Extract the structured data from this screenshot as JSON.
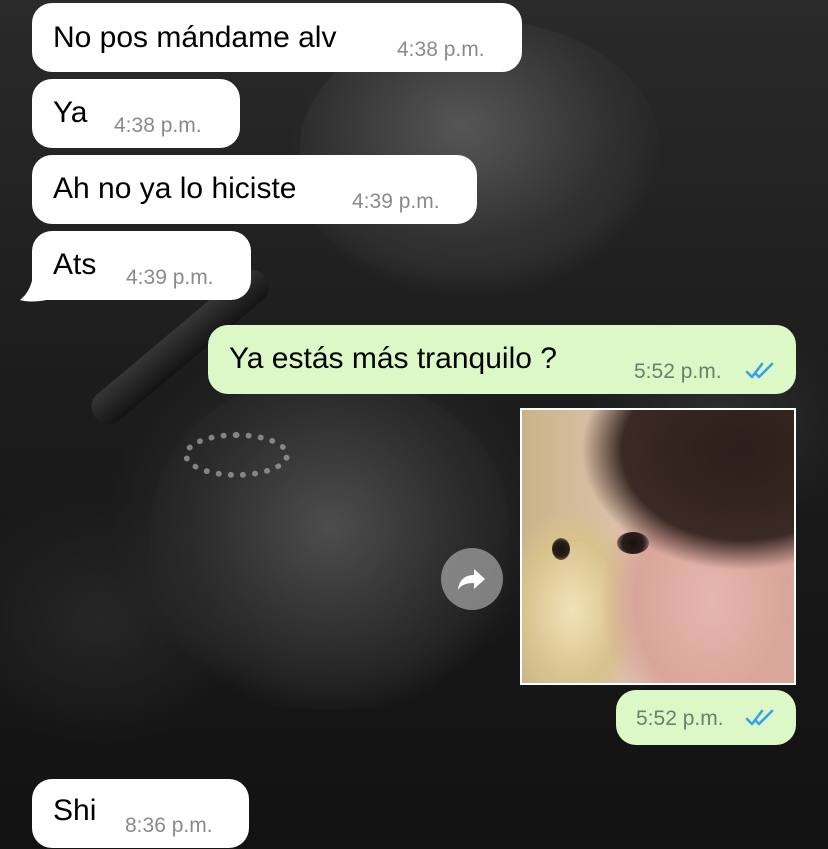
{
  "messages": [
    {
      "direction": "incoming",
      "text": "No pos mándame alv",
      "time": "4:38 p.m."
    },
    {
      "direction": "incoming",
      "text": "Ya",
      "time": "4:38 p.m."
    },
    {
      "direction": "incoming",
      "text": "Ah no ya lo hiciste",
      "time": "4:39 p.m."
    },
    {
      "direction": "incoming",
      "text": "Ats",
      "time": "4:39 p.m."
    },
    {
      "direction": "outgoing",
      "text": "Ya estás más tranquilo ?",
      "time": "5:52 p.m.",
      "status": "read"
    },
    {
      "direction": "outgoing",
      "type": "sticker",
      "image": "baby-face-sticker"
    },
    {
      "direction": "outgoing",
      "time": "5:52 p.m.",
      "status": "read"
    },
    {
      "direction": "incoming",
      "text": "Shi",
      "time": "8:36 p.m."
    }
  ],
  "icons": {
    "forward": "forward-arrow-icon",
    "read_receipt": "double-check-icon"
  },
  "colors": {
    "incoming_bubble": "#ffffff",
    "outgoing_bubble": "#dcf8c6",
    "read_ticks": "#34a3e8",
    "timestamp": "#8a8a8a"
  }
}
